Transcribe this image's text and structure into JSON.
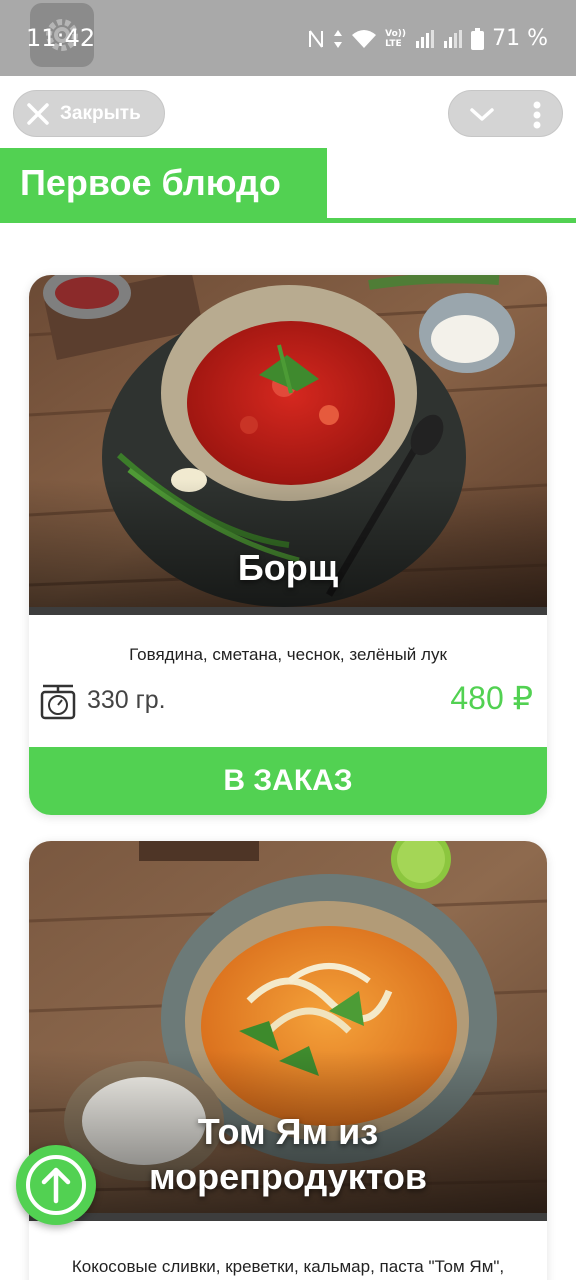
{
  "status_bar": {
    "time": "11:42",
    "battery": "71 %",
    "icons": [
      "settings-gear-icon",
      "nfc-icon",
      "data-arrows-icon",
      "wifi-icon",
      "volte-icon",
      "signal-icon",
      "signal-icon-2",
      "battery-icon"
    ],
    "volte_label": "Vo)) LTE"
  },
  "top_bar": {
    "close_label": "Закрыть"
  },
  "section": {
    "title": "Первое блюдо"
  },
  "dishes": [
    {
      "name": "Борщ",
      "ingredients": "Говядина, сметана, чеснок, зелёный лук",
      "weight": "330 гр.",
      "price": "480 ₽",
      "order_label": "В ЗАКАЗ"
    },
    {
      "name": "Том Ям из морепродуктов",
      "ingredients": "Кокосовые сливки, креветки, кальмар, паста \"Том Ям\","
    }
  ],
  "colors": {
    "accent": "#52d152",
    "status_bar": "#a9a9a9",
    "pill": "#d4d4d4"
  }
}
